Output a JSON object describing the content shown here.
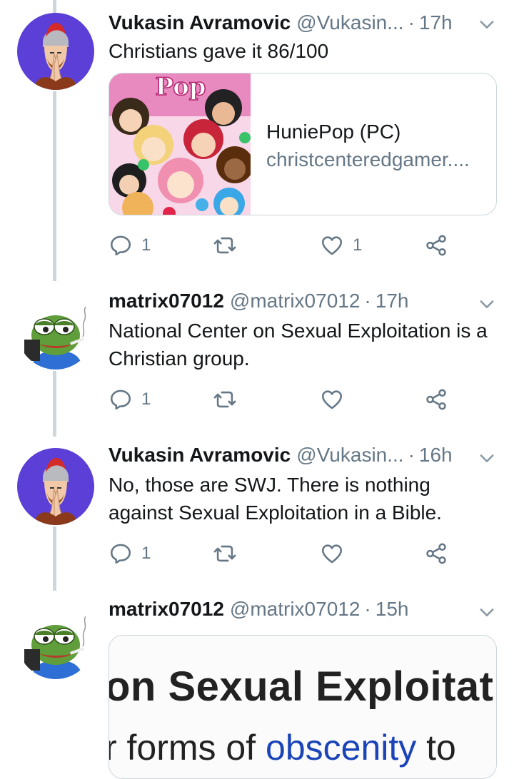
{
  "tweets": [
    {
      "name": "Vukasin Avramovic",
      "handle": "@Vukasin...",
      "time": "17h",
      "text": "Christians gave it 86/100",
      "card": {
        "title": "HuniePop (PC)",
        "domain": "christcenteredgamer....",
        "thumb_label": "Pop"
      },
      "replies": "1",
      "retweets": "",
      "likes": "1"
    },
    {
      "name": "matrix07012",
      "handle": "@matrix07012",
      "time": "17h",
      "text": "National Center on Sexual Exploitation is a Christian group.",
      "replies": "1",
      "retweets": "",
      "likes": ""
    },
    {
      "name": "Vukasin Avramovic",
      "handle": "@Vukasin...",
      "time": "16h",
      "text": "No, those are SWJ. There is nothing against Sexual Exploitation in a Bible.",
      "replies": "1",
      "retweets": "",
      "likes": ""
    },
    {
      "name": "matrix07012",
      "handle": "@matrix07012",
      "time": "15h",
      "embed": {
        "line1": "on Sexual Exploitatic",
        "line2_a": "r forms of ",
        "line2_b": "obscenity",
        "line2_c": " to"
      }
    }
  ],
  "separator": "·",
  "colors": {
    "text": "#14171a",
    "muted": "#657786",
    "border": "#ccd6dd",
    "thread": "#ccd6dd",
    "avatar_spartan_bg": "#5b3fd6",
    "avatar_pepe_bg": "#ffffff"
  },
  "icons": [
    "reply-icon",
    "retweet-icon",
    "like-icon",
    "share-icon",
    "chevron-down-icon"
  ]
}
